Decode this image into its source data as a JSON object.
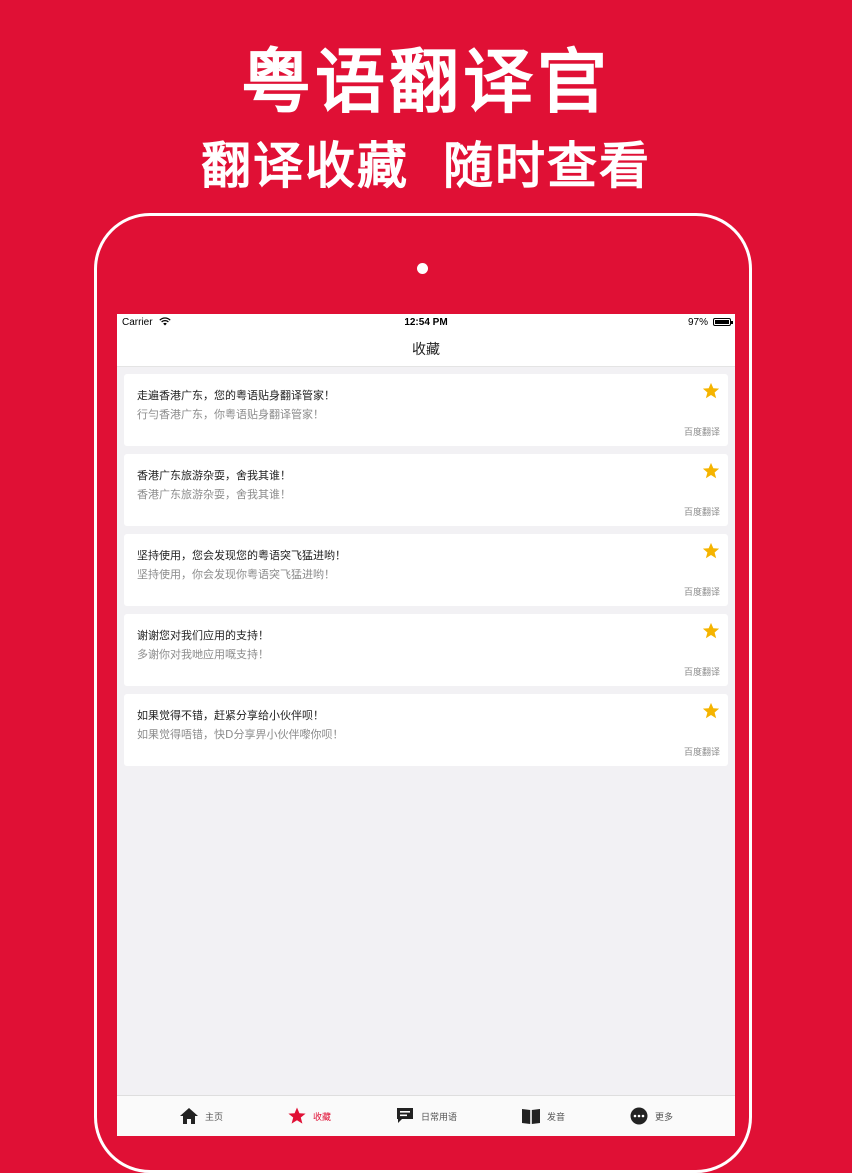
{
  "promo": {
    "title": "粤语翻译官",
    "subtitle_left": "翻译收藏",
    "subtitle_right": "随时查看"
  },
  "status_bar": {
    "carrier": "Carrier",
    "time": "12:54 PM",
    "battery": "97%"
  },
  "nav": {
    "title": "收藏"
  },
  "favorites": [
    {
      "source": "走遍香港广东，您的粤语贴身翻译管家！",
      "translation": "行勻香港广东，你粤语贴身翻译管家！",
      "engine": "百度翻译"
    },
    {
      "source": "香港广东旅游杂耍，舍我其谁！",
      "translation": "香港广东旅游杂耍，舍我其谁！",
      "engine": "百度翻译"
    },
    {
      "source": "坚持使用，您会发现您的粤语突飞猛进哟！",
      "translation": "坚持使用，你会发现你粤语突飞猛进哟！",
      "engine": "百度翻译"
    },
    {
      "source": "谢谢您对我们应用的支持！",
      "translation": "多谢你对我哋应用嘅支持！",
      "engine": "百度翻译"
    },
    {
      "source": "如果觉得不错，赶紧分享给小伙伴呗！",
      "translation": "如果觉得唔错，快D分享畀小伙伴嚟你呗！",
      "engine": "百度翻译"
    }
  ],
  "tabs": [
    {
      "label": "主页",
      "icon": "home-icon"
    },
    {
      "label": "收藏",
      "icon": "star-icon",
      "active": true
    },
    {
      "label": "日常用语",
      "icon": "chat-icon"
    },
    {
      "label": "发音",
      "icon": "book-icon"
    },
    {
      "label": "更多",
      "icon": "more-icon"
    }
  ],
  "colors": {
    "brand_red": "#e01035",
    "star_gold": "#f5b400",
    "screen_bg": "#f2f1f4"
  }
}
